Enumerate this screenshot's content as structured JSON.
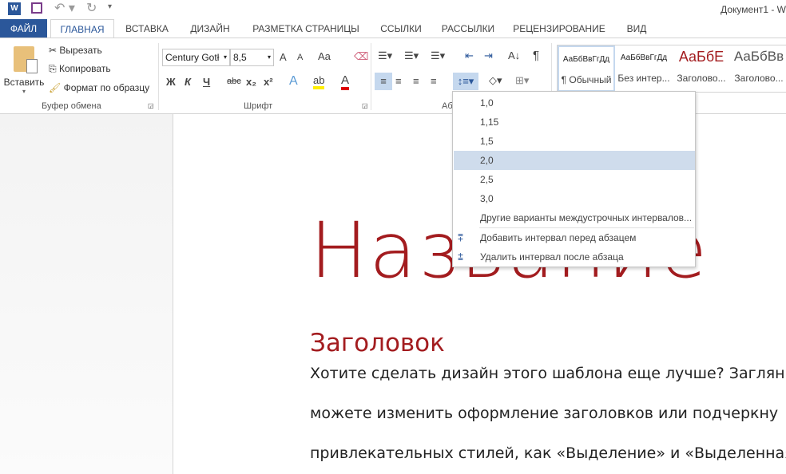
{
  "window": {
    "title": "Документ1 - W"
  },
  "quick_access": {
    "icons": [
      "word-logo-icon",
      "save-icon",
      "undo-icon",
      "redo-icon",
      "customize-icon"
    ]
  },
  "tabs": [
    {
      "label": "ФАЙЛ"
    },
    {
      "label": "ГЛАВНАЯ",
      "active": true
    },
    {
      "label": "ВСТАВКА"
    },
    {
      "label": "ДИЗАЙН"
    },
    {
      "label": "РАЗМЕТКА СТРАНИЦЫ"
    },
    {
      "label": "ССЫЛКИ"
    },
    {
      "label": "РАССЫЛКИ"
    },
    {
      "label": "РЕЦЕНЗИРОВАНИЕ"
    },
    {
      "label": "ВИД"
    }
  ],
  "clipboard": {
    "paste": "Вставить",
    "cut": "Вырезать",
    "copy": "Копировать",
    "format_painter": "Формат по образцу",
    "group": "Буфер обмена"
  },
  "font": {
    "name": "Century Gotł",
    "size": "8,5",
    "grow": "A",
    "shrink": "A",
    "case": "Aa",
    "bold": "Ж",
    "italic": "К",
    "underline": "Ч",
    "strike": "abc",
    "sub": "x₂",
    "sup": "x²",
    "group": "Шрифт"
  },
  "paragraph": {
    "group": "Аб"
  },
  "styles": [
    {
      "preview": "АаБбВвГгДд",
      "name": "¶ Обычный",
      "selected": true
    },
    {
      "preview": "АаБбВвГгДд",
      "name": "Без интер..."
    },
    {
      "preview": "АаБбЕ",
      "name": "Заголово...",
      "color": "#a31c1f"
    },
    {
      "preview": "АаБбВв",
      "name": "Заголово..."
    }
  ],
  "line_spacing_menu": {
    "options": [
      "1,0",
      "1,15",
      "1,5",
      "2,0",
      "2,5",
      "3,0"
    ],
    "selected": "2,0",
    "more": "Другие варианты междустрочных интервалов...",
    "add_before": "Добавить интервал перед абзацем",
    "remove_after": "Удалить интервал после абзаца"
  },
  "document": {
    "title": "Название",
    "heading": "Заголовок",
    "lines": [
      "Хотите сделать дизайн этого шаблона еще лучше? Загляни",
      "можете изменить оформление заголовков или подчеркну",
      "привлекательных стилей, как «Выделение» и «Выделенная"
    ]
  },
  "colors": {
    "accent": "#2b579a",
    "title_red": "#a31c1f"
  }
}
